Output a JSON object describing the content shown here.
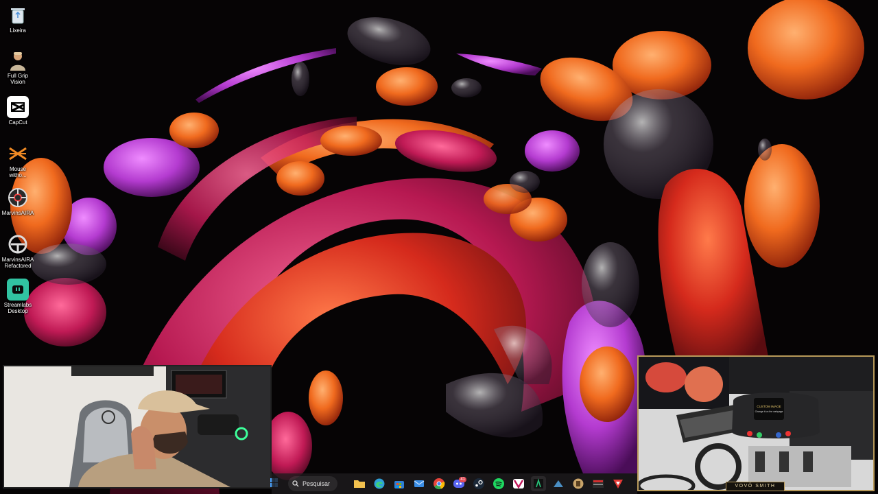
{
  "desktop": {
    "icons": [
      {
        "label": "Lixeira",
        "icon": "recycle-bin-icon"
      },
      {
        "label": "Full Grip Vision",
        "icon": "full-grip-vision-icon"
      },
      {
        "label": "CapCut",
        "icon": "capcut-icon"
      },
      {
        "label": "Mouse witho...",
        "icon": "mouse-without-borders-icon"
      },
      {
        "label": "MarvinsAIRA",
        "icon": "marvinsaira-icon"
      },
      {
        "label": "MarvinsAIRA Refactored",
        "icon": "marvinsaira-refactored-icon"
      },
      {
        "label": "Streamlabs Desktop",
        "icon": "streamlabs-icon"
      }
    ]
  },
  "taskbar": {
    "search_label": "Pesquisar",
    "apps": [
      {
        "name": "file-explorer",
        "color": "#f2c14e"
      },
      {
        "name": "edge",
        "color": "#2ea0d8"
      },
      {
        "name": "microsoft-store",
        "color": "#2d7fd6"
      },
      {
        "name": "mail",
        "color": "#3a8ee6"
      },
      {
        "name": "chrome",
        "color": "#e8453c"
      },
      {
        "name": "discord",
        "color": "#5865f2",
        "badge": "41"
      },
      {
        "name": "steam",
        "color": "#4a6d8f"
      },
      {
        "name": "spotify",
        "color": "#1ed760"
      },
      {
        "name": "simhub",
        "color": "#c2185b"
      },
      {
        "name": "iracing-ui",
        "color": "#27c47a"
      },
      {
        "name": "steam-2",
        "color": "#4a6d8f"
      },
      {
        "name": "app-beige",
        "color": "#c9a46a"
      },
      {
        "name": "app-red",
        "color": "#d32f2f"
      },
      {
        "name": "app-crimson",
        "color": "#e53935"
      }
    ]
  },
  "webcam_right": {
    "name_tag": "VOVÔ SMITH",
    "screen_text": "CUSTOM IMAGE",
    "screen_subtext": "Change it on the webpage"
  },
  "colors": {
    "accent_gold": "#b89a5a",
    "taskbar_bg": "#1e1c1e"
  }
}
